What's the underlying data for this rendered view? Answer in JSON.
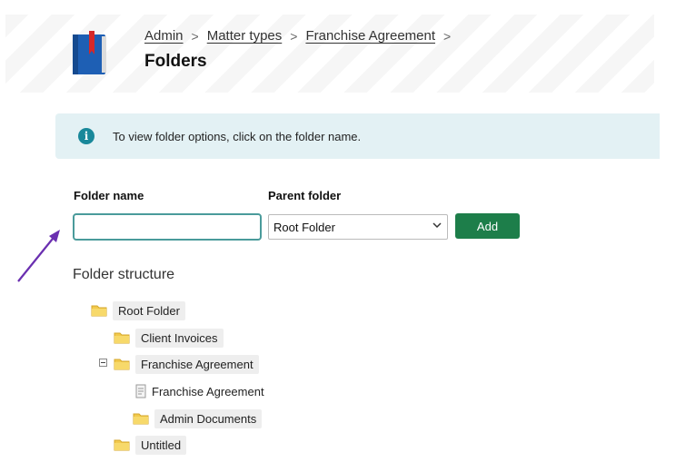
{
  "breadcrumb": {
    "items": [
      "Admin",
      "Matter types",
      "Franchise Agreement"
    ],
    "separator": ">"
  },
  "page": {
    "title": "Folders"
  },
  "info": {
    "text": "To view folder options, click on the folder name.",
    "icon": "i"
  },
  "form": {
    "folder_name_label": "Folder name",
    "folder_name_value": "",
    "parent_folder_label": "Parent folder",
    "parent_folder_selected": "Root Folder",
    "add_label": "Add"
  },
  "structure": {
    "title": "Folder structure",
    "nodes": [
      {
        "label": "Root Folder",
        "type": "folder"
      },
      {
        "label": "Client Invoices",
        "type": "folder"
      },
      {
        "label": "Franchise Agreement",
        "type": "folder"
      },
      {
        "label": "Franchise Agreement",
        "type": "document"
      },
      {
        "label": "Admin Documents",
        "type": "folder"
      },
      {
        "label": "Untitled",
        "type": "folder"
      }
    ]
  },
  "colors": {
    "accent_green": "#1d7e4a",
    "info_bg": "#e3f1f4",
    "info_icon": "#19889a",
    "arrow": "#6a2fb0",
    "folder": "#f2c94c"
  }
}
